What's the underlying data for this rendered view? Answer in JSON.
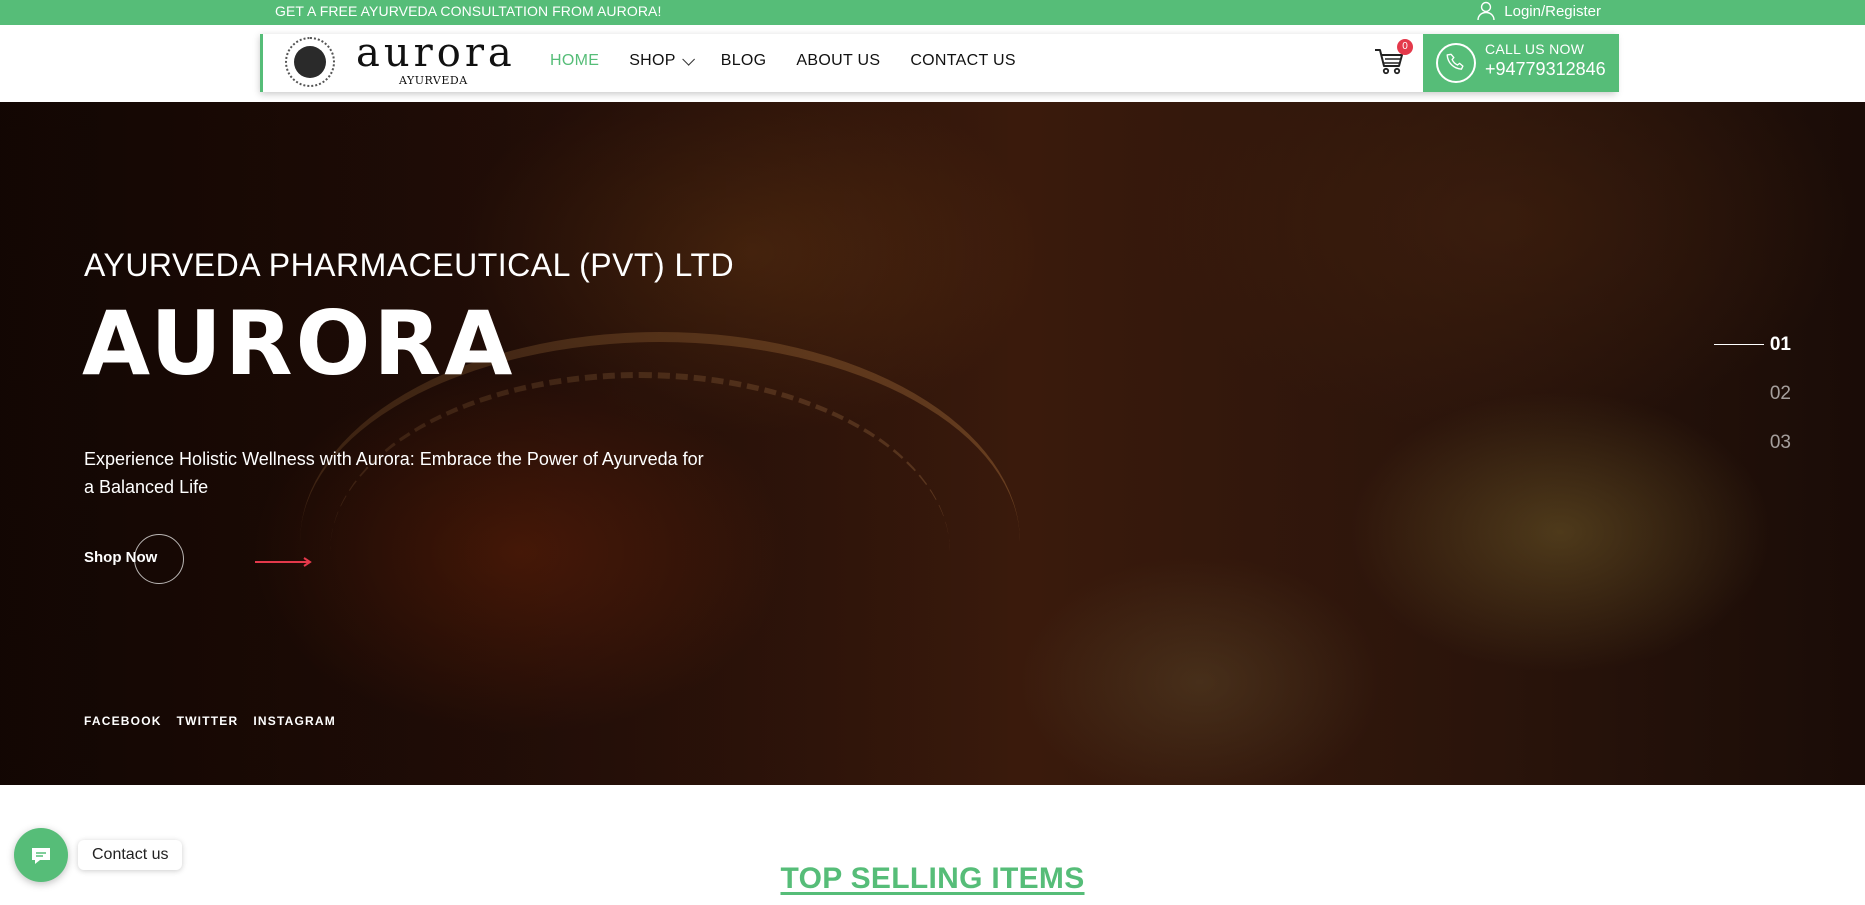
{
  "topbar": {
    "promo_text": "GET A FREE AYURVEDA CONSULTATION FROM AURORA!",
    "login_label": "Login/Register"
  },
  "header": {
    "brand": {
      "name": "aurora",
      "subtitle": "AYURVEDA"
    },
    "nav": [
      {
        "label": "HOME",
        "active": true
      },
      {
        "label": "SHOP",
        "has_dropdown": true
      },
      {
        "label": "BLOG"
      },
      {
        "label": "ABOUT US"
      },
      {
        "label": "CONTACT US"
      }
    ],
    "cart": {
      "count": "0"
    },
    "call": {
      "label": "CALL US NOW",
      "number": "+94779312846"
    }
  },
  "hero": {
    "eyebrow": "AYURVEDA PHARMACEUTICAL (PVT) LTD",
    "title": "AURORA",
    "description": "Experience Holistic Wellness with Aurora: Embrace the Power of Ayurveda for a Balanced Life",
    "cta_label": "Shop Now",
    "socials": [
      "FACEBOOK",
      "TWITTER",
      "INSTAGRAM"
    ],
    "slides": [
      "01",
      "02",
      "03"
    ],
    "active_slide": "01"
  },
  "contact_widget": {
    "label": "Contact us"
  },
  "section": {
    "title": "TOP SELLING ITEMS"
  },
  "colors": {
    "brand_green": "#56bd78",
    "badge_red": "#e4394b",
    "arrow_red": "#e4394b"
  },
  "icons": [
    "user-icon",
    "cart-icon",
    "phone-icon",
    "chat-icon",
    "arrow-right-icon",
    "chevron-down-icon"
  ]
}
